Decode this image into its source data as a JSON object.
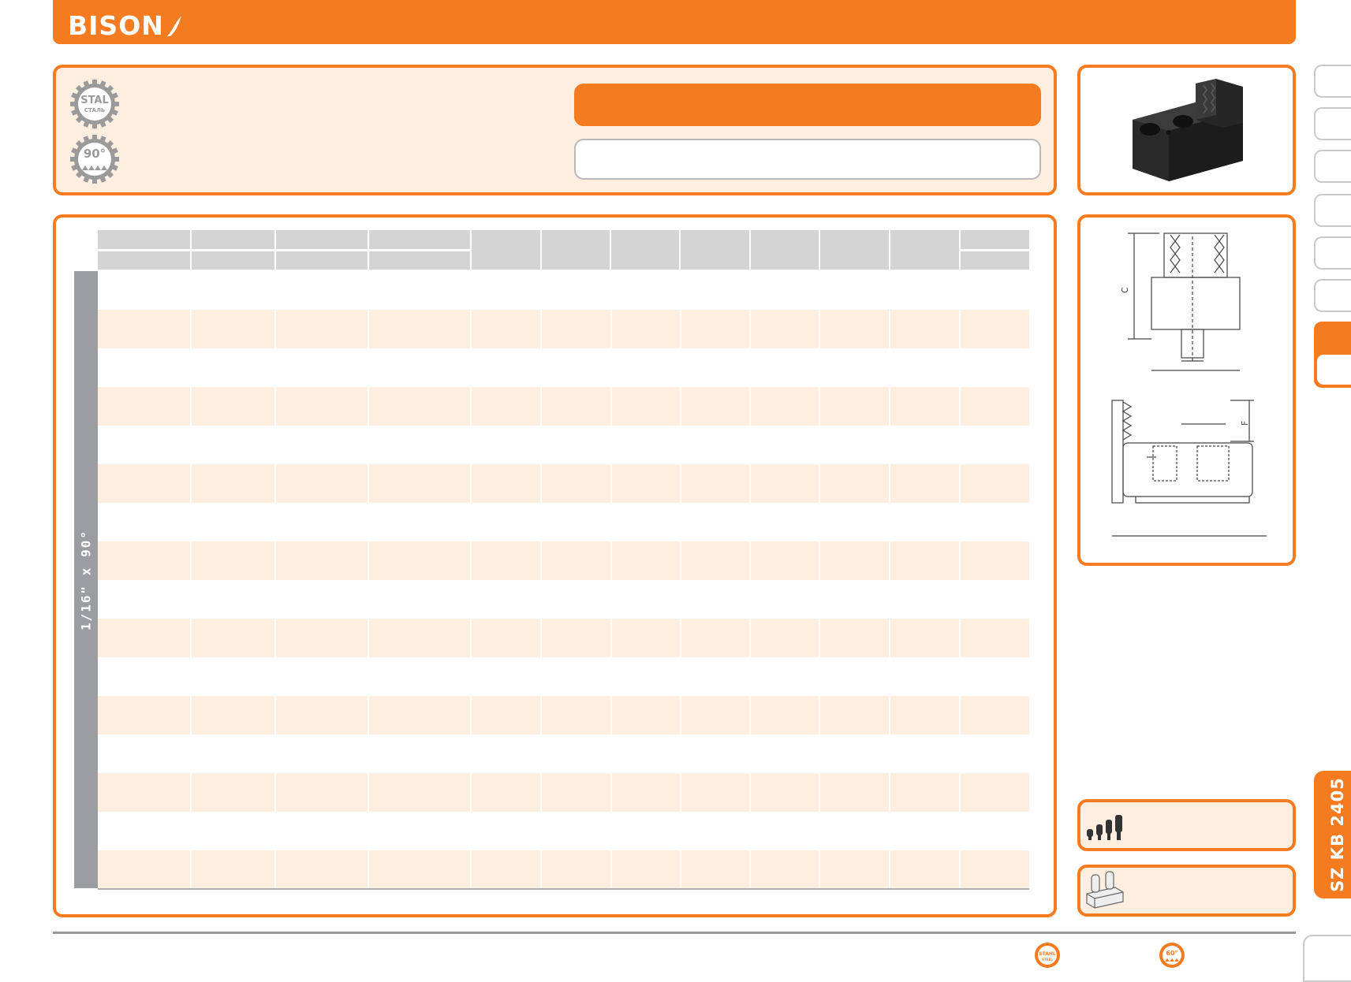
{
  "brand": {
    "logo_text": "BISON"
  },
  "badges": {
    "steel_top": "STAL",
    "steel_bottom": "СТАЛЬ",
    "angle": "90°",
    "footer_steel_top": "STAHL",
    "footer_steel_bottom": "STEEL",
    "footer_angle": "60°"
  },
  "table": {
    "side_label": "1/16\" x 90°",
    "row_count": 16
  },
  "drawing": {
    "dim_c": "C",
    "dim_f": "F"
  },
  "side_code": "SZ KB 2405",
  "colors": {
    "accent": "#f47b20",
    "row_tint": "#fdeee0",
    "header_gray": "#d4d4d4",
    "side_gray": "#9c9da0"
  }
}
